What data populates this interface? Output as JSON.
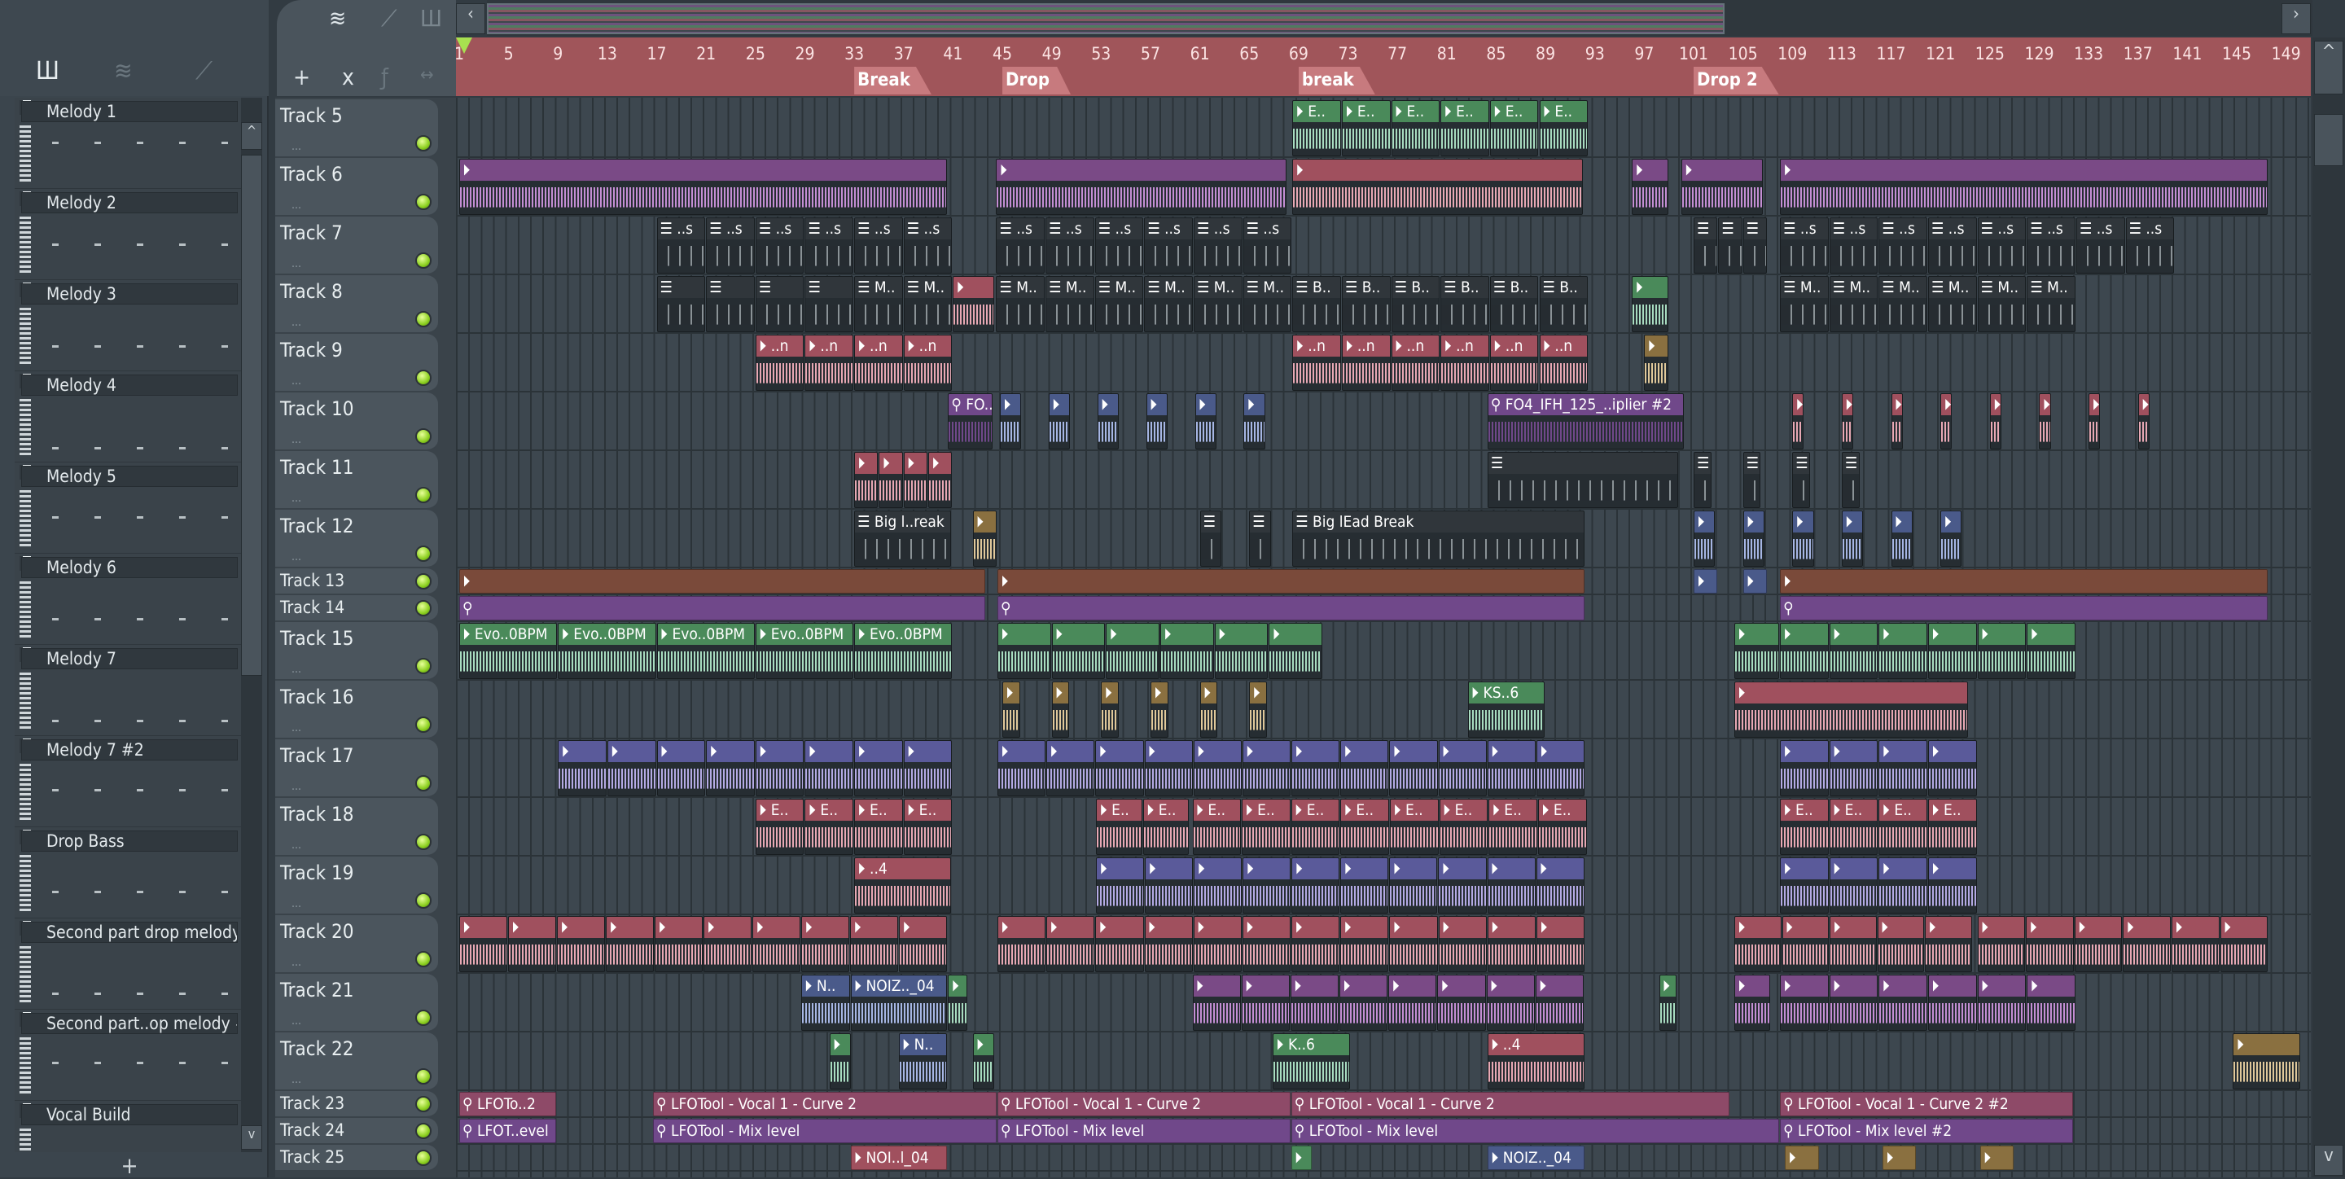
{
  "browser": {
    "tools": [
      "piano-roll-icon",
      "audio-icon",
      "automation-icon"
    ],
    "patterns": [
      "Melody 1",
      "Melody 2",
      "Melody 3",
      "Melody 4",
      "Melody 5",
      "Melody 6",
      "Melody 7",
      "Melody 7 #2",
      "Drop Bass",
      "Second part drop melody",
      "Second part..op melody #2",
      "Vocal Build"
    ],
    "add_label": "+"
  },
  "toolbar": {
    "add": "+",
    "delete": "x"
  },
  "ruler": {
    "ticks": [
      "1",
      "5",
      "9",
      "13",
      "17",
      "21",
      "25",
      "29",
      "33",
      "37",
      "41",
      "45",
      "49",
      "53",
      "57",
      "61",
      "65",
      "69",
      "73",
      "77",
      "81",
      "85",
      "89",
      "93",
      "97",
      "101",
      "105",
      "109",
      "113",
      "117",
      "121",
      "125",
      "129",
      "133",
      "137",
      "141",
      "145",
      "149"
    ],
    "markers": [
      {
        "label": "Break",
        "bar": 33
      },
      {
        "label": "Drop",
        "bar": 45
      },
      {
        "label": "break",
        "bar": 69
      },
      {
        "label": "Drop 2",
        "bar": 101
      }
    ]
  },
  "tracks": [
    {
      "name": "Track 5",
      "thin": false
    },
    {
      "name": "Track 6",
      "thin": false
    },
    {
      "name": "Track 7",
      "thin": false
    },
    {
      "name": "Track 8",
      "thin": false
    },
    {
      "name": "Track 9",
      "thin": false
    },
    {
      "name": "Track 10",
      "thin": false
    },
    {
      "name": "Track 11",
      "thin": false
    },
    {
      "name": "Track 12",
      "thin": false
    },
    {
      "name": "Track 13",
      "thin": true
    },
    {
      "name": "Track 14",
      "thin": true
    },
    {
      "name": "Track 15",
      "thin": false
    },
    {
      "name": "Track 16",
      "thin": false
    },
    {
      "name": "Track 17",
      "thin": false
    },
    {
      "name": "Track 18",
      "thin": false
    },
    {
      "name": "Track 19",
      "thin": false
    },
    {
      "name": "Track 20",
      "thin": false
    },
    {
      "name": "Track 21",
      "thin": false
    },
    {
      "name": "Track 22",
      "thin": false
    },
    {
      "name": "Track 23",
      "thin": true
    },
    {
      "name": "Track 24",
      "thin": true
    },
    {
      "name": "Track 25",
      "thin": true
    }
  ],
  "colors": {
    "green": [
      "#4a8a5a",
      "#a8dcc0"
    ],
    "purple": [
      "#7a4a86",
      "#c48ed4"
    ],
    "pink": [
      "#a0505e",
      "#e8a8b4"
    ],
    "gray": [
      "#30363b",
      "#262c31"
    ],
    "blue": [
      "#4a5a8a",
      "#a6b6e4"
    ],
    "lilac": [
      "#5a5a9a",
      "#b4aae4"
    ],
    "gold": [
      "#8a7040",
      "#e0c89a"
    ],
    "magenta": [
      "#8e4a68",
      "#8e4a68"
    ],
    "violet": [
      "#70488a",
      "#70488a"
    ],
    "orange": [
      "#7a4a3a",
      "#7a4a3a"
    ]
  },
  "clips": [
    {
      "t": 0,
      "s": 68.5,
      "n": 6,
      "l": 4,
      "label": "E..",
      "c": "green"
    },
    {
      "t": 1,
      "s": 1,
      "n": 1,
      "l": 39.6,
      "label": "",
      "c": "purple"
    },
    {
      "t": 1,
      "s": 44.5,
      "n": 1,
      "l": 23.6,
      "label": "",
      "c": "purple"
    },
    {
      "t": 1,
      "s": 68.5,
      "n": 1,
      "l": 23.6,
      "label": "",
      "c": "pink"
    },
    {
      "t": 1,
      "s": 96,
      "n": 1,
      "l": 3,
      "label": "",
      "c": "purple"
    },
    {
      "t": 1,
      "s": 100,
      "n": 1,
      "l": 6.7,
      "label": "",
      "c": "purple"
    },
    {
      "t": 1,
      "s": 108,
      "n": 1,
      "l": 39.6,
      "label": "",
      "c": "purple"
    },
    {
      "t": 2,
      "s": 17,
      "n": 6,
      "l": 4,
      "label": "..s",
      "c": "gray"
    },
    {
      "t": 2,
      "s": 44.5,
      "n": 6,
      "l": 4,
      "label": "..s",
      "c": "gray"
    },
    {
      "t": 2,
      "s": 101,
      "n": 3,
      "l": 2,
      "label": "",
      "c": "gray"
    },
    {
      "t": 2,
      "s": 108,
      "n": 8,
      "l": 4,
      "label": "..s",
      "c": "gray"
    },
    {
      "t": 3,
      "s": 17,
      "n": 4,
      "l": 4,
      "label": "",
      "c": "gray"
    },
    {
      "t": 3,
      "s": 33,
      "n": 2,
      "l": 4,
      "label": "M..",
      "c": "gray"
    },
    {
      "t": 3,
      "s": 41,
      "n": 1,
      "l": 3.4,
      "label": "",
      "c": "pink"
    },
    {
      "t": 3,
      "s": 44.5,
      "n": 6,
      "l": 4,
      "label": "M..",
      "c": "gray"
    },
    {
      "t": 3,
      "s": 68.5,
      "n": 6,
      "l": 4,
      "label": "B..",
      "c": "gray"
    },
    {
      "t": 3,
      "s": 96,
      "n": 1,
      "l": 3,
      "label": "",
      "c": "green"
    },
    {
      "t": 3,
      "s": 108,
      "n": 6,
      "l": 4,
      "label": "M..",
      "c": "gray"
    },
    {
      "t": 4,
      "s": 25,
      "n": 4,
      "l": 4,
      "label": "..n",
      "c": "pink"
    },
    {
      "t": 4,
      "s": 68.5,
      "n": 6,
      "l": 4,
      "label": "..n",
      "c": "pink"
    },
    {
      "t": 4,
      "s": 97,
      "n": 1,
      "l": 2,
      "label": "",
      "c": "gold"
    },
    {
      "t": 5,
      "s": 40.6,
      "n": 1,
      "l": 3.7,
      "label": "FO..",
      "c": "violet"
    },
    {
      "t": 5,
      "s": 44.8,
      "n": 6,
      "l": 3.95,
      "label": "",
      "c": "blue",
      "w": 1.8
    },
    {
      "t": 5,
      "s": 84.3,
      "n": 1,
      "l": 16,
      "label": "FO4_IFH_125_..iplier #2",
      "c": "violet"
    },
    {
      "t": 5,
      "s": 109,
      "n": 8,
      "l": 4,
      "label": "",
      "c": "pink",
      "w": 1
    },
    {
      "t": 6,
      "s": 33,
      "n": 4,
      "l": 2,
      "label": "",
      "c": "pink"
    },
    {
      "t": 6,
      "s": 84.3,
      "n": 1,
      "l": 15.5,
      "label": "",
      "c": "gray"
    },
    {
      "t": 6,
      "s": 101,
      "n": 4,
      "l": 4,
      "label": "",
      "c": "gray",
      "w": 1.5
    },
    {
      "t": 7,
      "s": 33,
      "n": 1,
      "l": 7.9,
      "label": "Big l..reak",
      "c": "gray"
    },
    {
      "t": 7,
      "s": 42.6,
      "n": 1,
      "l": 2,
      "label": "",
      "c": "gold"
    },
    {
      "t": 7,
      "s": 61,
      "n": 2,
      "l": 4,
      "label": "",
      "c": "gray",
      "w": 1.8
    },
    {
      "t": 7,
      "s": 68.5,
      "n": 1,
      "l": 23.7,
      "label": "Big lEad Break",
      "c": "gray"
    },
    {
      "t": 7,
      "s": 101,
      "n": 6,
      "l": 4,
      "label": "",
      "c": "blue",
      "w": 1.8
    },
    {
      "t": 8,
      "s": 1,
      "n": 1,
      "l": 42.7,
      "label": "",
      "c": "orange"
    },
    {
      "t": 8,
      "s": 44.6,
      "n": 1,
      "l": 47.6,
      "label": "",
      "c": "orange"
    },
    {
      "t": 8,
      "s": 101,
      "n": 2,
      "l": 4,
      "label": "",
      "c": "blue",
      "w": 2
    },
    {
      "t": 8,
      "s": 108,
      "n": 1,
      "l": 39.6,
      "label": "",
      "c": "orange"
    },
    {
      "t": 9,
      "s": 1,
      "n": 1,
      "l": 42.7,
      "label": "",
      "c": "violet"
    },
    {
      "t": 9,
      "s": 44.6,
      "n": 1,
      "l": 47.6,
      "label": "",
      "c": "violet"
    },
    {
      "t": 9,
      "s": 108,
      "n": 1,
      "l": 39.6,
      "label": "",
      "c": "violet"
    },
    {
      "t": 10,
      "s": 1,
      "n": 5,
      "l": 8,
      "label": "Evo..0BPM",
      "c": "green"
    },
    {
      "t": 10,
      "s": 44.6,
      "n": 6,
      "l": 4.4,
      "label": "",
      "c": "green"
    },
    {
      "t": 10,
      "s": 104.3,
      "n": 1,
      "l": 3.7,
      "label": "",
      "c": "green"
    },
    {
      "t": 10,
      "s": 108,
      "n": 6,
      "l": 4,
      "label": "",
      "c": "green"
    },
    {
      "t": 11,
      "s": 45,
      "n": 6,
      "l": 4,
      "label": "",
      "c": "gold",
      "w": 1.5
    },
    {
      "t": 11,
      "s": 82.7,
      "n": 1,
      "l": 6.3,
      "label": "KS..6",
      "c": "green"
    },
    {
      "t": 11,
      "s": 104.3,
      "n": 1,
      "l": 19,
      "label": "",
      "c": "pink"
    },
    {
      "t": 12,
      "s": 9,
      "n": 8,
      "l": 4,
      "label": "",
      "c": "lilac"
    },
    {
      "t": 12,
      "s": 44.6,
      "n": 12,
      "l": 3.97,
      "label": "",
      "c": "lilac"
    },
    {
      "t": 12,
      "s": 108,
      "n": 4,
      "l": 4,
      "label": "",
      "c": "lilac"
    },
    {
      "t": 13,
      "s": 25,
      "n": 4,
      "l": 4,
      "label": "E..",
      "c": "pink"
    },
    {
      "t": 13,
      "s": 52.6,
      "n": 2,
      "l": 3.8,
      "label": "E..",
      "c": "pink"
    },
    {
      "t": 13,
      "s": 60.4,
      "n": 8,
      "l": 4,
      "label": "E..",
      "c": "pink"
    },
    {
      "t": 13,
      "s": 108,
      "n": 4,
      "l": 4,
      "label": "E..",
      "c": "pink"
    },
    {
      "t": 14,
      "s": 33,
      "n": 1,
      "l": 7.9,
      "label": "..4",
      "c": "pink"
    },
    {
      "t": 14,
      "s": 52.6,
      "n": 10,
      "l": 3.96,
      "label": "",
      "c": "lilac"
    },
    {
      "t": 14,
      "s": 108,
      "n": 4,
      "l": 4,
      "label": "",
      "c": "lilac"
    },
    {
      "t": 15,
      "s": 1,
      "n": 10,
      "l": 3.96,
      "label": "",
      "c": "pink"
    },
    {
      "t": 15,
      "s": 44.6,
      "n": 12,
      "l": 3.97,
      "label": "",
      "c": "pink"
    },
    {
      "t": 15,
      "s": 104.3,
      "n": 5,
      "l": 3.86,
      "label": "",
      "c": "pink"
    },
    {
      "t": 15,
      "s": 124,
      "n": 6,
      "l": 3.93,
      "label": "",
      "c": "pink"
    },
    {
      "t": 16,
      "s": 28.7,
      "n": 1,
      "l": 4,
      "label": "N..",
      "c": "blue"
    },
    {
      "t": 16,
      "s": 32.7,
      "n": 1,
      "l": 7.9,
      "label": "NOIZ.._04",
      "c": "blue"
    },
    {
      "t": 16,
      "s": 40.6,
      "n": 1,
      "l": 1.6,
      "label": "",
      "c": "green"
    },
    {
      "t": 16,
      "s": 60.4,
      "n": 8,
      "l": 3.97,
      "label": "",
      "c": "purple"
    },
    {
      "t": 16,
      "s": 98.2,
      "n": 1,
      "l": 1.5,
      "label": "",
      "c": "green"
    },
    {
      "t": 16,
      "s": 104.3,
      "n": 1,
      "l": 3,
      "label": "",
      "c": "purple"
    },
    {
      "t": 16,
      "s": 108,
      "n": 4,
      "l": 4,
      "label": "",
      "c": "purple"
    },
    {
      "t": 16,
      "s": 124,
      "n": 2,
      "l": 4,
      "label": "",
      "c": "purple"
    },
    {
      "t": 17,
      "s": 31,
      "n": 1,
      "l": 1.8,
      "label": "",
      "c": "green"
    },
    {
      "t": 17,
      "s": 36.6,
      "n": 1,
      "l": 4,
      "label": "N..",
      "c": "blue"
    },
    {
      "t": 17,
      "s": 42.6,
      "n": 1,
      "l": 1.8,
      "label": "",
      "c": "green"
    },
    {
      "t": 17,
      "s": 66.9,
      "n": 1,
      "l": 6.3,
      "label": "K..6",
      "c": "green"
    },
    {
      "t": 17,
      "s": 84.3,
      "n": 1,
      "l": 7.9,
      "label": "..4",
      "c": "pink"
    },
    {
      "t": 17,
      "s": 144.7,
      "n": 1,
      "l": 5.5,
      "label": "",
      "c": "gold"
    },
    {
      "t": 18,
      "s": 1,
      "n": 1,
      "l": 7.9,
      "label": "LFOTo..2",
      "c": "magenta"
    },
    {
      "t": 18,
      "s": 16.7,
      "n": 1,
      "l": 27.9,
      "label": "LFOTool - Vocal 1 - Curve  2",
      "c": "magenta"
    },
    {
      "t": 18,
      "s": 44.6,
      "n": 1,
      "l": 23.8,
      "label": "LFOTool - Vocal 1 - Curve  2",
      "c": "magenta"
    },
    {
      "t": 18,
      "s": 68.4,
      "n": 1,
      "l": 35.6,
      "label": "LFOTool - Vocal 1 - Curve  2",
      "c": "magenta"
    },
    {
      "t": 18,
      "s": 108,
      "n": 1,
      "l": 23.8,
      "label": "LFOTool - Vocal 1 - Curve  2 #2",
      "c": "magenta"
    },
    {
      "t": 19,
      "s": 1,
      "n": 1,
      "l": 7.9,
      "label": "LFOT..evel",
      "c": "violet"
    },
    {
      "t": 19,
      "s": 16.7,
      "n": 1,
      "l": 27.9,
      "label": "LFOTool - Mix level",
      "c": "violet"
    },
    {
      "t": 19,
      "s": 44.6,
      "n": 1,
      "l": 23.8,
      "label": "LFOTool - Mix level",
      "c": "violet"
    },
    {
      "t": 19,
      "s": 68.4,
      "n": 1,
      "l": 39.6,
      "label": "LFOTool - Mix level",
      "c": "violet"
    },
    {
      "t": 19,
      "s": 108,
      "n": 1,
      "l": 23.8,
      "label": "LFOTool - Mix level #2",
      "c": "violet"
    },
    {
      "t": 20,
      "s": 32.7,
      "n": 1,
      "l": 7.9,
      "label": "NOI..l_04",
      "c": "pink"
    },
    {
      "t": 20,
      "s": 68.4,
      "n": 1,
      "l": 1.7,
      "label": "",
      "c": "green"
    },
    {
      "t": 20,
      "s": 84.3,
      "n": 1,
      "l": 7.9,
      "label": "NOIZ.._04",
      "c": "blue"
    },
    {
      "t": 20,
      "s": 108.4,
      "n": 3,
      "l": 7.9,
      "label": "",
      "c": "gold",
      "w": 2.8
    }
  ]
}
